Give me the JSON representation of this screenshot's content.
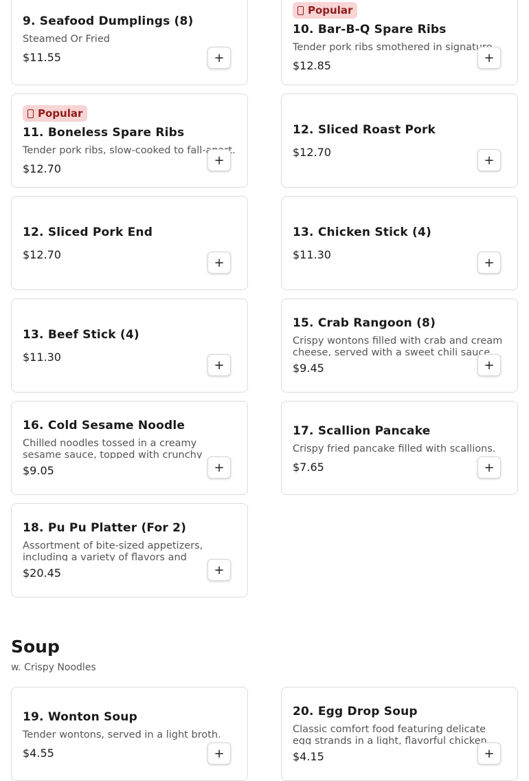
{
  "menu": {
    "items": [
      {
        "name": "9. Seafood Dumplings (8)",
        "description": "Steamed Or Fried",
        "price": "$11.55",
        "badge": ""
      },
      {
        "name": "10. Bar-B-Q Spare Ribs",
        "description": "Tender pork ribs smothered in signature",
        "price": "$12.85",
        "badge": "Popular"
      },
      {
        "name": "11. Boneless Spare Ribs",
        "description": "Tender pork ribs, slow-cooked to fall-apart...",
        "price": "$12.70",
        "badge": "Popular"
      },
      {
        "name": "12. Sliced Roast Pork",
        "description": "",
        "price": "$12.70",
        "badge": ""
      },
      {
        "name": "12. Sliced Pork End",
        "description": "",
        "price": "$12.70",
        "badge": ""
      },
      {
        "name": "13. Chicken Stick (4)",
        "description": "",
        "price": "$11.30",
        "badge": ""
      },
      {
        "name": "13. Beef Stick (4)",
        "description": "",
        "price": "$11.30",
        "badge": ""
      },
      {
        "name": "15. Crab Rangoon (8)",
        "description": "Crispy wontons filled with crab and cream cheese, served with a sweet chili sauce",
        "price": "$9.45",
        "badge": ""
      },
      {
        "name": "16. Cold Sesame Noodle",
        "description": "Chilled noodles tossed in a creamy sesame sauce, topped with crunchy elements and...",
        "price": "$9.05",
        "badge": ""
      },
      {
        "name": "17. Scallion Pancake",
        "description": "Crispy fried pancake filled with scallions.",
        "price": "$7.65",
        "badge": ""
      },
      {
        "name": "18. Pu Pu Platter (For 2)",
        "description": "Assortment of bite-sized appetizers, including a variety of flavors and textures...",
        "price": "$20.45",
        "badge": ""
      }
    ],
    "add_label": "+",
    "badge_icon": "fire-icon"
  },
  "soup": {
    "title": "Soup",
    "subtitle": "w. Crispy Noodles",
    "items": [
      {
        "name": "19. Wonton Soup",
        "description": "Tender wontons, served in a light broth.",
        "price": "$4.55"
      },
      {
        "name": "20. Egg Drop Soup",
        "description": "Classic comfort food featuring delicate egg strands in a light, flavorful chicken broth.",
        "price": "$4.15"
      }
    ]
  },
  "colors": {
    "badge_bg": "#f8d4d4",
    "badge_text": "#8f1d1d"
  }
}
